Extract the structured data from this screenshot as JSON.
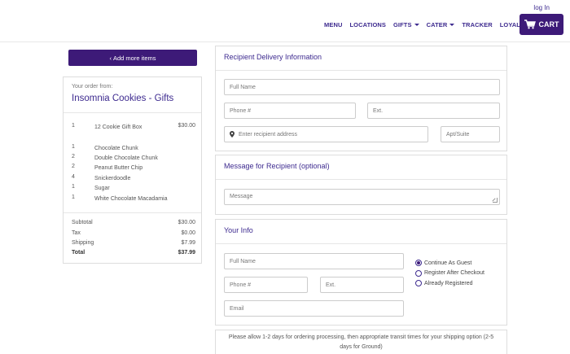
{
  "header": {
    "login_label": "log In",
    "nav": [
      {
        "label": "MENU",
        "dropdown": false
      },
      {
        "label": "LOCATIONS",
        "dropdown": false
      },
      {
        "label": "GIFTS",
        "dropdown": true
      },
      {
        "label": "CATER",
        "dropdown": true
      },
      {
        "label": "TRACKER",
        "dropdown": false
      },
      {
        "label": "LOYALTY",
        "dropdown": false
      }
    ],
    "cart_label": "CART",
    "cart_icon": "cart-icon"
  },
  "sidebar": {
    "add_more_label": "Add more items",
    "order_from_label": "Your order from:",
    "store_name": "Insomnia Cookies - Gifts",
    "items": [
      {
        "qty": "1",
        "name": "12 Cookie Gift Box",
        "price": "$30.00"
      },
      {
        "qty": "1",
        "name": "Chocolate Chunk",
        "price": ""
      },
      {
        "qty": "2",
        "name": "Double Chocolate Chunk",
        "price": ""
      },
      {
        "qty": "2",
        "name": "Peanut Butter Chip",
        "price": ""
      },
      {
        "qty": "4",
        "name": "Snickerdoodle",
        "price": ""
      },
      {
        "qty": "1",
        "name": "Sugar",
        "price": ""
      },
      {
        "qty": "1",
        "name": "White Chocolate Macadamia",
        "price": ""
      }
    ],
    "totals": {
      "subtotal_label": "Subtotal",
      "subtotal": "$30.00",
      "tax_label": "Tax",
      "tax": "$0.00",
      "shipping_label": "Shipping",
      "shipping": "$7.99",
      "total_label": "Total",
      "total": "$37.99"
    }
  },
  "recipient": {
    "title": "Recipient Delivery Information",
    "full_name_placeholder": "Full Name",
    "phone_placeholder": "Phone #",
    "ext_placeholder": "Ext.",
    "address_placeholder": "Enter recipient address",
    "apt_placeholder": "Apt/Suite"
  },
  "message": {
    "title": "Message for Recipient (optional)",
    "message_placeholder": "Message"
  },
  "your_info": {
    "title": "Your Info",
    "full_name_placeholder": "Full Name",
    "phone_placeholder": "Phone #",
    "ext_placeholder": "Ext.",
    "email_placeholder": "Email",
    "options": [
      {
        "label": "Continue As Guest",
        "selected": true
      },
      {
        "label": "Register After Checkout",
        "selected": false
      },
      {
        "label": "Already Registered",
        "selected": false
      }
    ]
  },
  "notice": "Please allow 1-2 days for ordering processing, then appropriate transit times for your shipping option (2-5 days for Ground)",
  "colors": {
    "brand": "#3d1a78",
    "accent_text": "#3d2a8f"
  }
}
